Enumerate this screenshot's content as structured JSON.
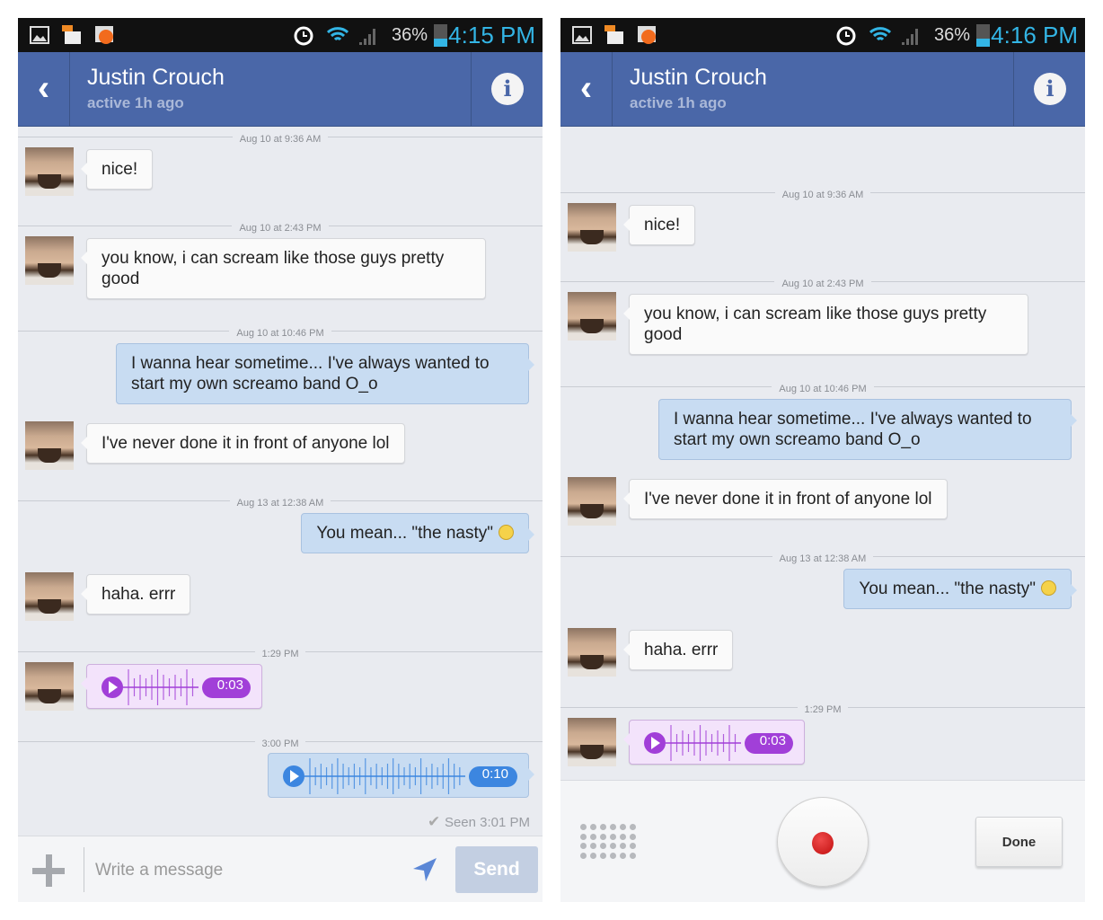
{
  "colors": {
    "header": "#4a67a8",
    "sent_bubble": "#c8dcf2",
    "audio_recv": "#a13fd8",
    "audio_sent": "#3c86e0",
    "clock": "#33b5e5"
  },
  "screens": [
    {
      "status": {
        "battery": "36%",
        "battery_level": 0.36,
        "time": "4:15 PM",
        "icons": [
          "gallery-icon",
          "messenger-notification-icon",
          "chat-heads-icon",
          "alarm-icon",
          "wifi-icon",
          "signal-icon",
          "battery-icon"
        ]
      },
      "header": {
        "name": "Justin Crouch",
        "subtitle": "active 1h ago"
      },
      "composer": {
        "placeholder": "Write a message",
        "send_label": "Send"
      }
    },
    {
      "status": {
        "battery": "36%",
        "battery_level": 0.36,
        "time": "4:16 PM",
        "icons": [
          "gallery-icon",
          "messenger-notification-icon",
          "chat-heads-icon",
          "alarm-icon",
          "wifi-icon",
          "signal-icon",
          "battery-icon"
        ]
      },
      "header": {
        "name": "Justin Crouch",
        "subtitle": "active 1h ago"
      },
      "record_bar": {
        "done_label": "Done"
      }
    }
  ],
  "messages": [
    {
      "type": "divider",
      "text": "Aug 10 at 9:36 AM"
    },
    {
      "type": "recv",
      "text": "nice!"
    },
    {
      "type": "divider",
      "text": "Aug 10 at 2:43 PM"
    },
    {
      "type": "recv",
      "text": "you know, i can scream like those guys pretty good"
    },
    {
      "type": "divider",
      "text": "Aug 10 at 10:46 PM"
    },
    {
      "type": "sent",
      "text": "I wanna hear sometime... I've always wanted to start my own screamo band O_o"
    },
    {
      "type": "recv",
      "text": "I've never done it in front of anyone lol"
    },
    {
      "type": "divider",
      "text": "Aug 13 at 12:38 AM"
    },
    {
      "type": "sent",
      "text": "You mean... \"the nasty\"",
      "emoji": "grimace-emoji"
    },
    {
      "type": "recv",
      "text": "haha. errr"
    },
    {
      "type": "divider",
      "text": "1:29 PM"
    },
    {
      "type": "audio-recv",
      "duration": "0:03"
    },
    {
      "type": "divider",
      "text": "3:00 PM"
    },
    {
      "type": "audio-sent",
      "duration": "0:10"
    },
    {
      "type": "seen",
      "text": "Seen 3:01 PM"
    }
  ]
}
